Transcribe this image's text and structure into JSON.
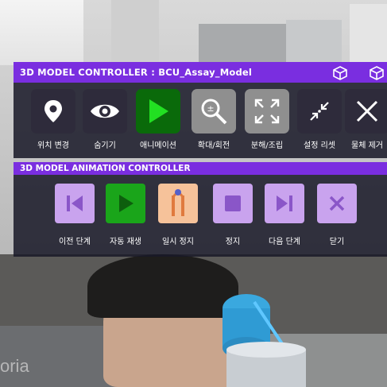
{
  "controller": {
    "title": "3D MODEL CONTROLLER : BCU_Assay_Model",
    "header_icons": [
      "cube-icon",
      "cube-icon"
    ],
    "buttons": [
      {
        "label": "위치 변경",
        "icon": "map-pin-icon",
        "state": "normal"
      },
      {
        "label": "숨기기",
        "icon": "eye-icon",
        "state": "normal"
      },
      {
        "label": "애니메이션",
        "icon": "play-icon",
        "state": "active"
      },
      {
        "label": "확대/회전",
        "icon": "zoom-rotate-icon",
        "state": "disabled"
      },
      {
        "label": "분해/조립",
        "icon": "expand-icon",
        "state": "disabled"
      },
      {
        "label": "설정 리셋",
        "icon": "collapse-icon",
        "state": "normal"
      },
      {
        "label": "물체 제거",
        "icon": "close-icon",
        "state": "normal"
      }
    ]
  },
  "animation": {
    "title": "3D MODEL ANIMATION CONTROLLER",
    "buttons": [
      {
        "label": "이전 단계",
        "icon": "previous-step-icon"
      },
      {
        "label": "자동 재생",
        "icon": "play-icon"
      },
      {
        "label": "일시 정지",
        "icon": "pause-cursor-icon"
      },
      {
        "label": "정지",
        "icon": "stop-icon"
      },
      {
        "label": "다음 단계",
        "icon": "next-step-icon"
      },
      {
        "label": "닫기",
        "icon": "close-icon"
      }
    ]
  },
  "watermark": "oria",
  "colors": {
    "accent": "#7a2ee0",
    "panel": "#19192a",
    "active_green": "#0a6a0a",
    "play_green": "#1aa51a",
    "lavender": "#c9a3ee",
    "peach": "#f6c29a"
  }
}
